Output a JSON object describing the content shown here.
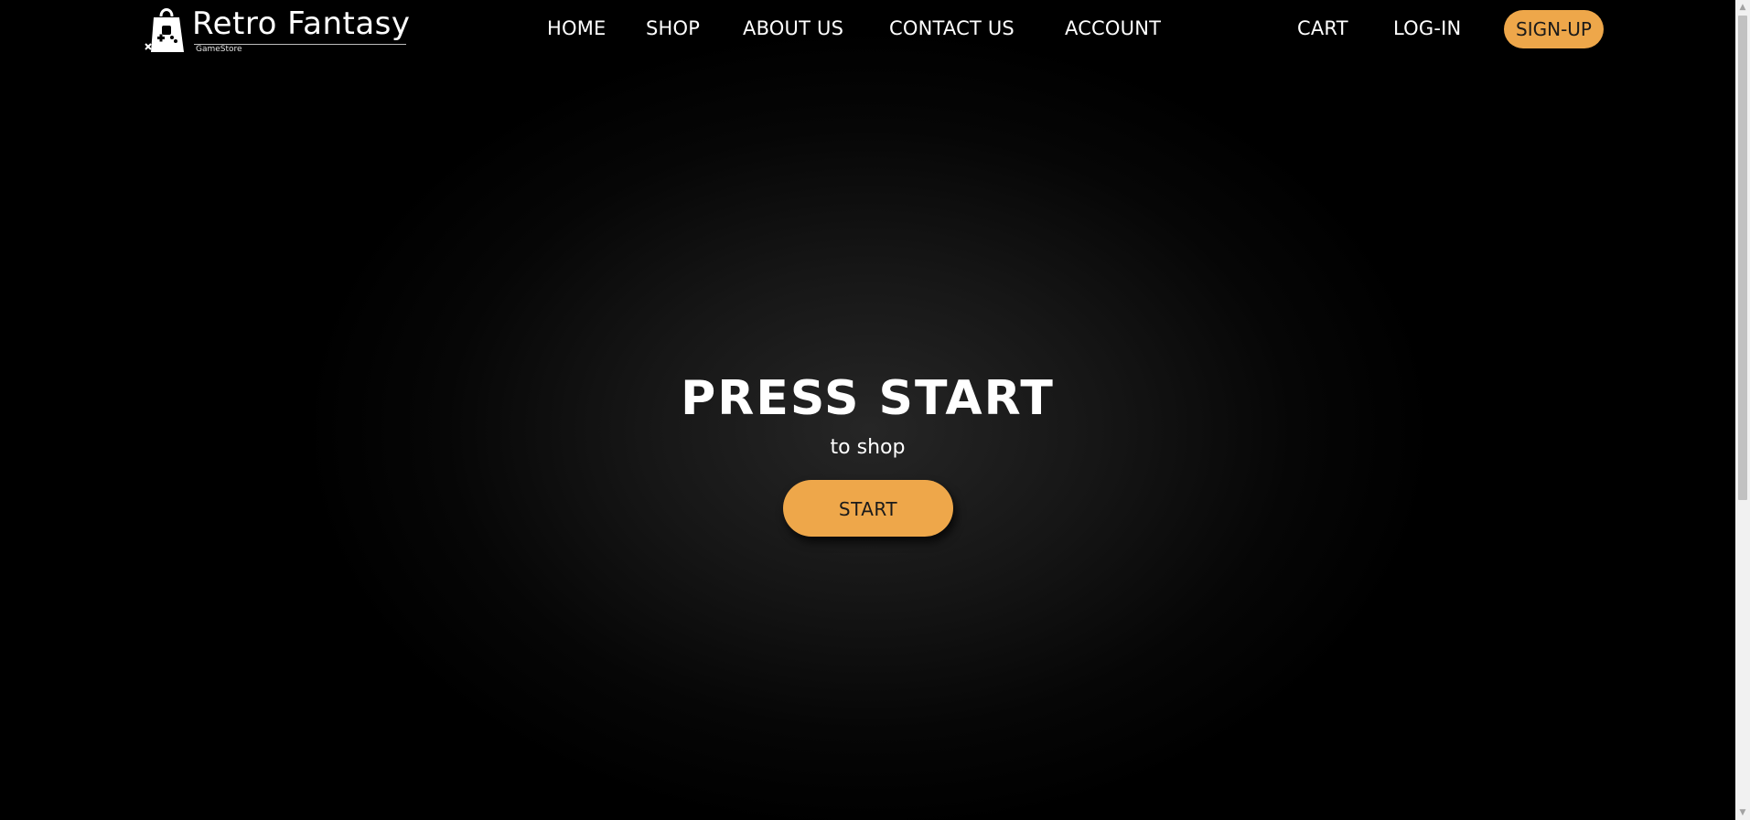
{
  "brand": {
    "name": "Retro Fantasy",
    "tagline": "GameStore",
    "logo_icon": "shopping-bag-gamepad-icon"
  },
  "nav": {
    "items": [
      {
        "label": "HOME"
      },
      {
        "label": "SHOP"
      },
      {
        "label": "ABOUT US"
      },
      {
        "label": "CONTACT US"
      },
      {
        "label": "ACCOUNT"
      }
    ],
    "cart_label": "CART",
    "login_label": "LOG-IN",
    "signup_label": "SIGN-UP"
  },
  "hero": {
    "title": "PRESS START",
    "subtitle": "to shop",
    "button_label": "START"
  },
  "colors": {
    "accent": "#eea74a",
    "background": "#000000",
    "text": "#ffffff"
  }
}
